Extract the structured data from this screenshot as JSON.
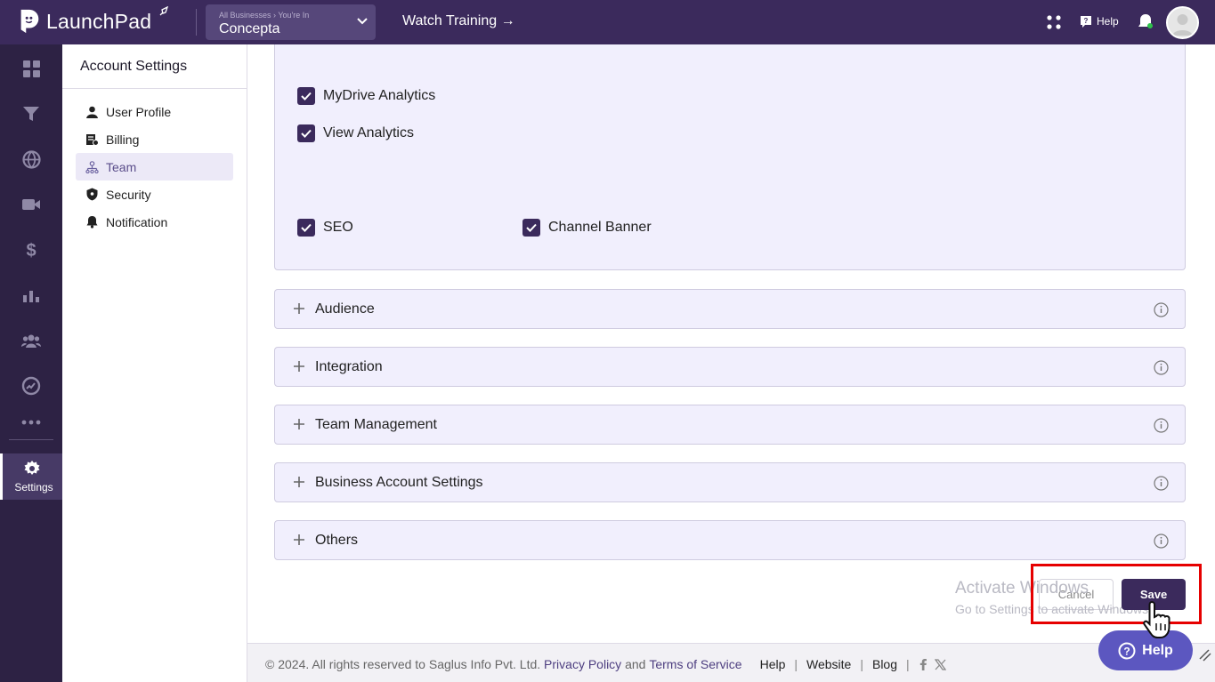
{
  "app": {
    "name": "LaunchPad"
  },
  "business": {
    "sub_label": "All Businesses  ›  You're In",
    "name": "Concepta"
  },
  "header": {
    "watch_training": "Watch Training →",
    "help_label": "Help"
  },
  "rail": {
    "items": [
      "dashboard-icon",
      "funnel-icon",
      "globe-icon",
      "video-icon",
      "dollar-icon",
      "analytics-icon",
      "team-icon",
      "reports-icon",
      "more-icon"
    ],
    "settings_label": "Settings"
  },
  "side": {
    "title": "Account Settings",
    "items": [
      {
        "label": "User Profile",
        "icon": "user-icon"
      },
      {
        "label": "Billing",
        "icon": "billing-icon"
      },
      {
        "label": "Team",
        "icon": "team-icon",
        "active": true
      },
      {
        "label": "Security",
        "icon": "shield-icon"
      },
      {
        "label": "Notification",
        "icon": "bell-icon"
      }
    ]
  },
  "permissions": {
    "mydrive_analytics": "MyDrive Analytics",
    "view_analytics": "View Analytics",
    "seo": "SEO",
    "channel_banner": "Channel Banner"
  },
  "sections": [
    "Audience",
    "Integration",
    "Team Management",
    "Business Account Settings",
    "Others"
  ],
  "actions": {
    "cancel": "Cancel",
    "save": "Save"
  },
  "watermark": {
    "line1": "Activate Windows",
    "line2": "Go to Settings to activate Windows."
  },
  "footer": {
    "copyright": "©  2024. All rights reserved to Saglus Info Pvt. Ltd.",
    "privacy": "Privacy Policy",
    "and": "and",
    "terms": "Terms of Service",
    "help": "Help",
    "website": "Website",
    "blog": "Blog"
  },
  "help_button": "Help",
  "colors": {
    "brand": "#3b2a5c",
    "accent": "#5c57c0",
    "highlight": "#e60000"
  }
}
